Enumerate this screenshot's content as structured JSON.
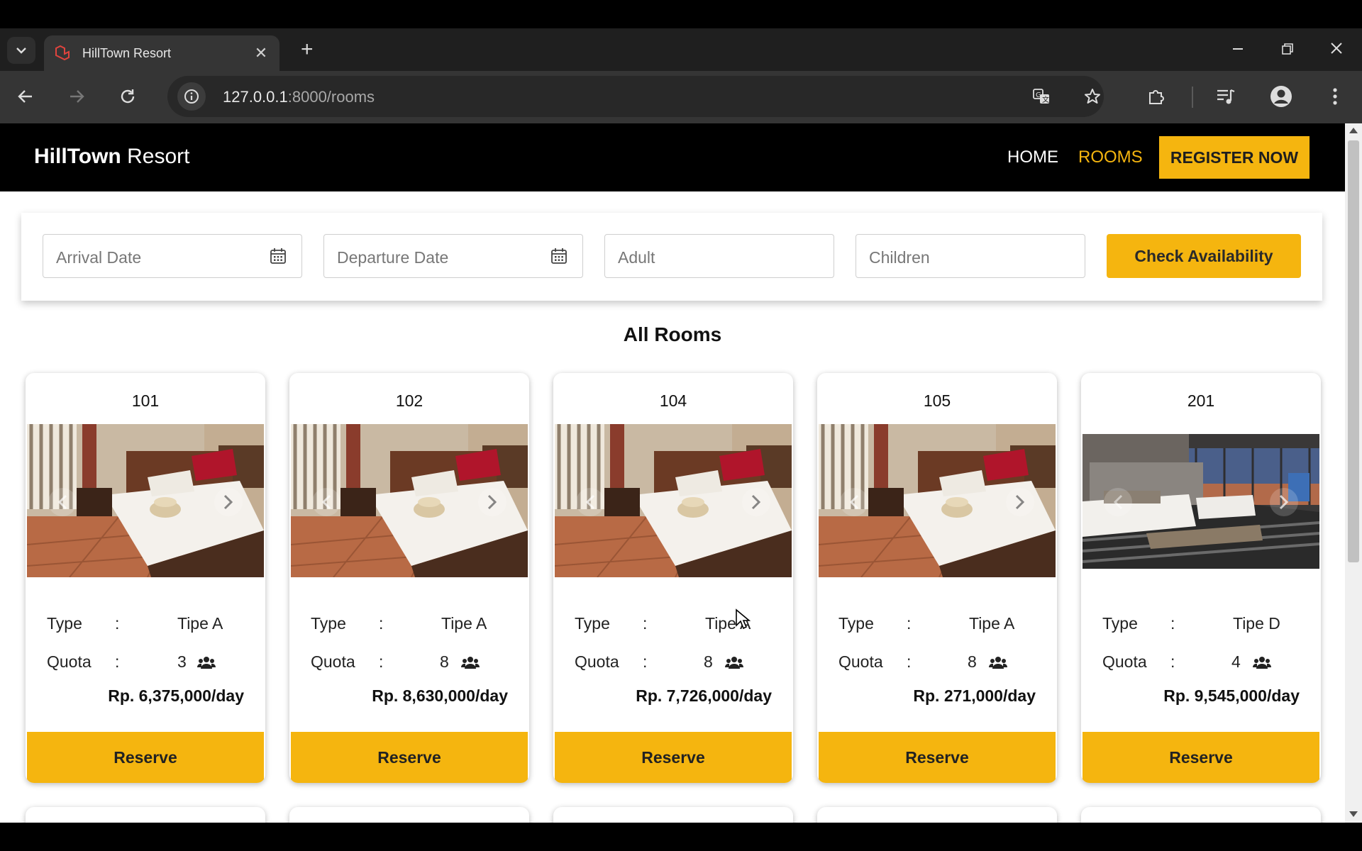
{
  "browser": {
    "tab_title": "HillTown Resort",
    "url_host": "127.0.0.1",
    "url_path": ":8000/rooms"
  },
  "site": {
    "brand_bold": "HillTown",
    "brand_light": "Resort",
    "nav": {
      "home": "HOME",
      "rooms": "ROOMS",
      "register": "REGISTER NOW"
    }
  },
  "search": {
    "arrival_placeholder": "Arrival Date",
    "departure_placeholder": "Departure Date",
    "adult_placeholder": "Adult",
    "children_placeholder": "Children",
    "check_label": "Check Availability"
  },
  "rooms_title": "All Rooms",
  "labels": {
    "type": "Type",
    "quota": "Quota",
    "colon": ":",
    "reserve": "Reserve"
  },
  "rooms": [
    {
      "number": "101",
      "type": "Tipe A",
      "quota": "3",
      "price": "Rp. 6,375,000/day",
      "image": "bedroom-photo"
    },
    {
      "number": "102",
      "type": "Tipe A",
      "quota": "8",
      "price": "Rp. 8,630,000/day",
      "image": "bedroom-photo"
    },
    {
      "number": "104",
      "type": "Tipe A",
      "quota": "8",
      "price": "Rp. 7,726,000/day",
      "image": "bedroom-photo"
    },
    {
      "number": "105",
      "type": "Tipe A",
      "quota": "8",
      "price": "Rp. 271,000/day",
      "image": "bedroom-photo"
    },
    {
      "number": "201",
      "type": "Tipe D",
      "quota": "4",
      "price": "Rp. 9,545,000/day",
      "image": "suite-photo"
    }
  ],
  "colors": {
    "accent": "#f5b50f",
    "header_bg": "#000000"
  }
}
